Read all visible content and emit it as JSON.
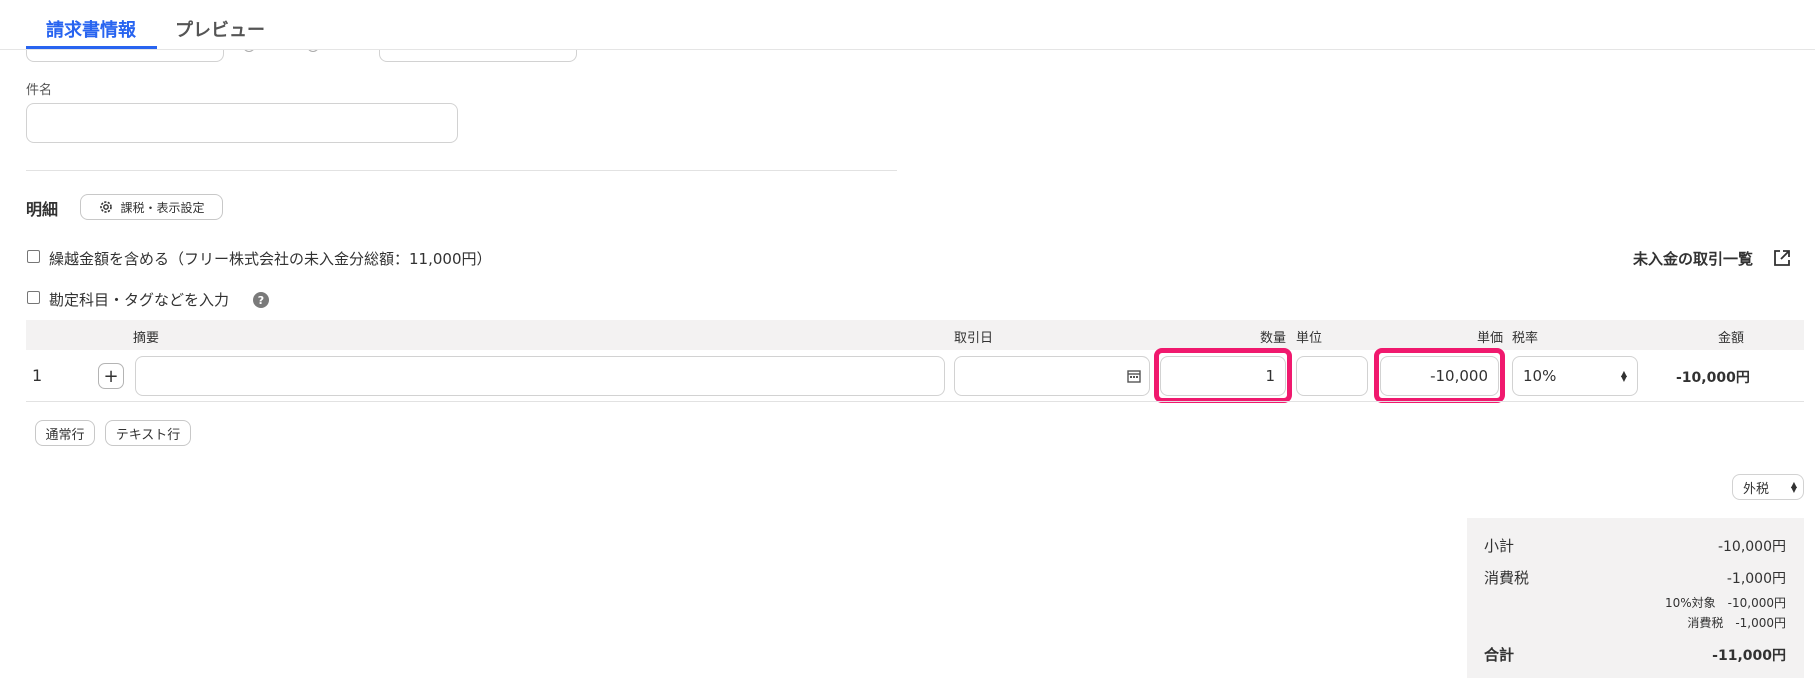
{
  "tabs": [
    {
      "label": "請求書情報",
      "active": true
    },
    {
      "label": "プレビュー",
      "active": false
    }
  ],
  "subject": {
    "label": "件名",
    "value": ""
  },
  "details": {
    "title": "明細",
    "settings_button": "課税・表示設定",
    "carryover_checkbox": {
      "label": "繰越金額を含める（フリー株式会社の未入金分総額：11,000円）",
      "checked": false
    },
    "account_checkbox": {
      "label": "勘定科目・タグなどを入力",
      "checked": false
    },
    "help_icon": "question-icon",
    "unpaid_link": "未入金の取引一覧",
    "unpaid_link_icon": "external-link-icon"
  },
  "table": {
    "headers": {
      "summary": "摘要",
      "date": "取引日",
      "quantity": "数量",
      "unit": "単位",
      "unit_price": "単価",
      "tax_rate": "税率",
      "amount": "金額"
    },
    "rows": [
      {
        "no": "1",
        "summary": "",
        "date": "",
        "quantity": "1",
        "unit": "",
        "unit_price": "-10,000",
        "tax_rate": "10%",
        "amount": "-10,000円"
      }
    ],
    "add_normal_row": "通常行",
    "add_text_row": "テキスト行"
  },
  "tax_mode": {
    "selected": "外税"
  },
  "totals": {
    "subtotal_label": "小計",
    "subtotal_value": "-10,000円",
    "tax_label": "消費税",
    "tax_value": "-1,000円",
    "breakdown_target": "10%対象　-10,000円",
    "breakdown_tax": "消費税　-1,000円",
    "total_label": "合計",
    "total_value": "-11,000円"
  },
  "colors": {
    "accent": "#2864f0",
    "highlight": "#f0196e"
  }
}
